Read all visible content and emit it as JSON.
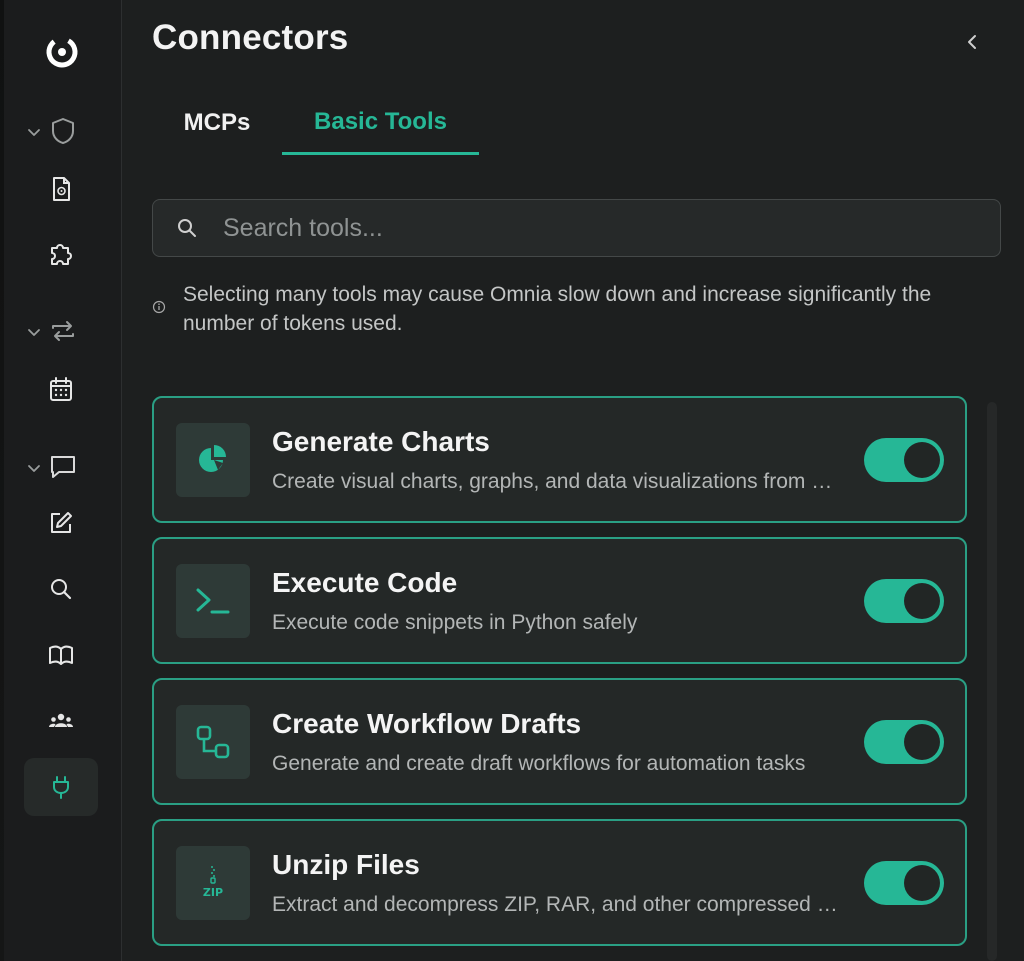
{
  "header": {
    "title": "Connectors"
  },
  "tabs": [
    {
      "label": "MCPs",
      "active": false
    },
    {
      "label": "Basic Tools",
      "active": true
    }
  ],
  "search": {
    "placeholder": "Search tools...",
    "value": ""
  },
  "notice": {
    "text": "Selecting many tools may cause Omnia slow down and increase significantly the number of tokens used."
  },
  "tools": [
    {
      "name": "Generate Charts",
      "description": "Create visual charts, graphs, and data visualizations from data",
      "icon": "pie-chart-icon",
      "enabled": true
    },
    {
      "name": "Execute Code",
      "description": "Execute code snippets in Python safely",
      "icon": "terminal-icon",
      "enabled": true
    },
    {
      "name": "Create Workflow Drafts",
      "description": "Generate and create draft workflows for automation tasks",
      "icon": "workflow-icon",
      "enabled": true
    },
    {
      "name": "Unzip Files",
      "description": "Extract and decompress ZIP, RAR, and other compressed archives",
      "icon": "zip-file-icon",
      "enabled": true
    }
  ],
  "sidebar": {
    "items": [
      {
        "icon": "app-logo-icon"
      },
      {
        "icon": "shield-icon",
        "group": true
      },
      {
        "icon": "document-icon"
      },
      {
        "icon": "puzzle-icon"
      },
      {
        "icon": "repeat-icon",
        "group": true
      },
      {
        "icon": "calendar-icon"
      },
      {
        "icon": "chat-icon",
        "group": true
      },
      {
        "icon": "edit-icon"
      },
      {
        "icon": "search-icon"
      },
      {
        "icon": "book-icon"
      },
      {
        "icon": "team-icon"
      },
      {
        "icon": "plug-icon",
        "active": true
      }
    ]
  },
  "colors": {
    "accent": "#26b796",
    "background": "#1d1f1f",
    "card": "#242827",
    "card_border": "#2a9f84"
  }
}
